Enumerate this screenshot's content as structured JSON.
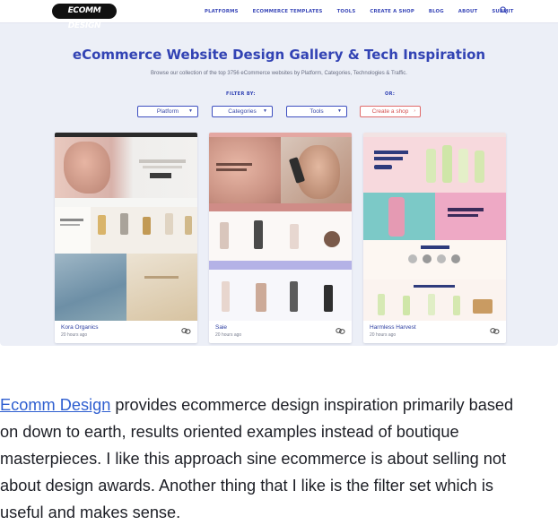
{
  "nav": {
    "logo": "ECOMM DESIGN",
    "items": [
      "PLATFORMS",
      "ECOMMERCE TEMPLATES",
      "TOOLS",
      "CREATE A SHOP",
      "BLOG",
      "ABOUT",
      "SUBMIT"
    ]
  },
  "hero": {
    "title": "eCommerce Website Design Gallery & Tech Inspiration",
    "subtitle": "Browse our collection of the top 3756 eCommerce websites by Platform, Categories, Technologies & Traffic.",
    "filter_label": "FILTER BY:",
    "or_label": "OR:"
  },
  "filters": [
    "Platform",
    "Categories",
    "Tools"
  ],
  "create_shop": "Create a shop",
  "cards": [
    {
      "name": "Kora Organics",
      "time": "20 hours ago"
    },
    {
      "name": "Saie",
      "time": "20 hours ago"
    },
    {
      "name": "Harmless Harvest",
      "time": "20 hours ago"
    }
  ],
  "article": {
    "link_text": "Ecomm Design",
    "line1_rest": " provides ecommerce design inspiration primarily based",
    "line2": "on down to earth, results oriented examples instead of boutique",
    "line3": "masterpieces. I like this approach sine ecommerce is about selling not",
    "line4": "about design awards. Another thing that I like is the filter set which is",
    "line5": "useful and makes sense."
  }
}
